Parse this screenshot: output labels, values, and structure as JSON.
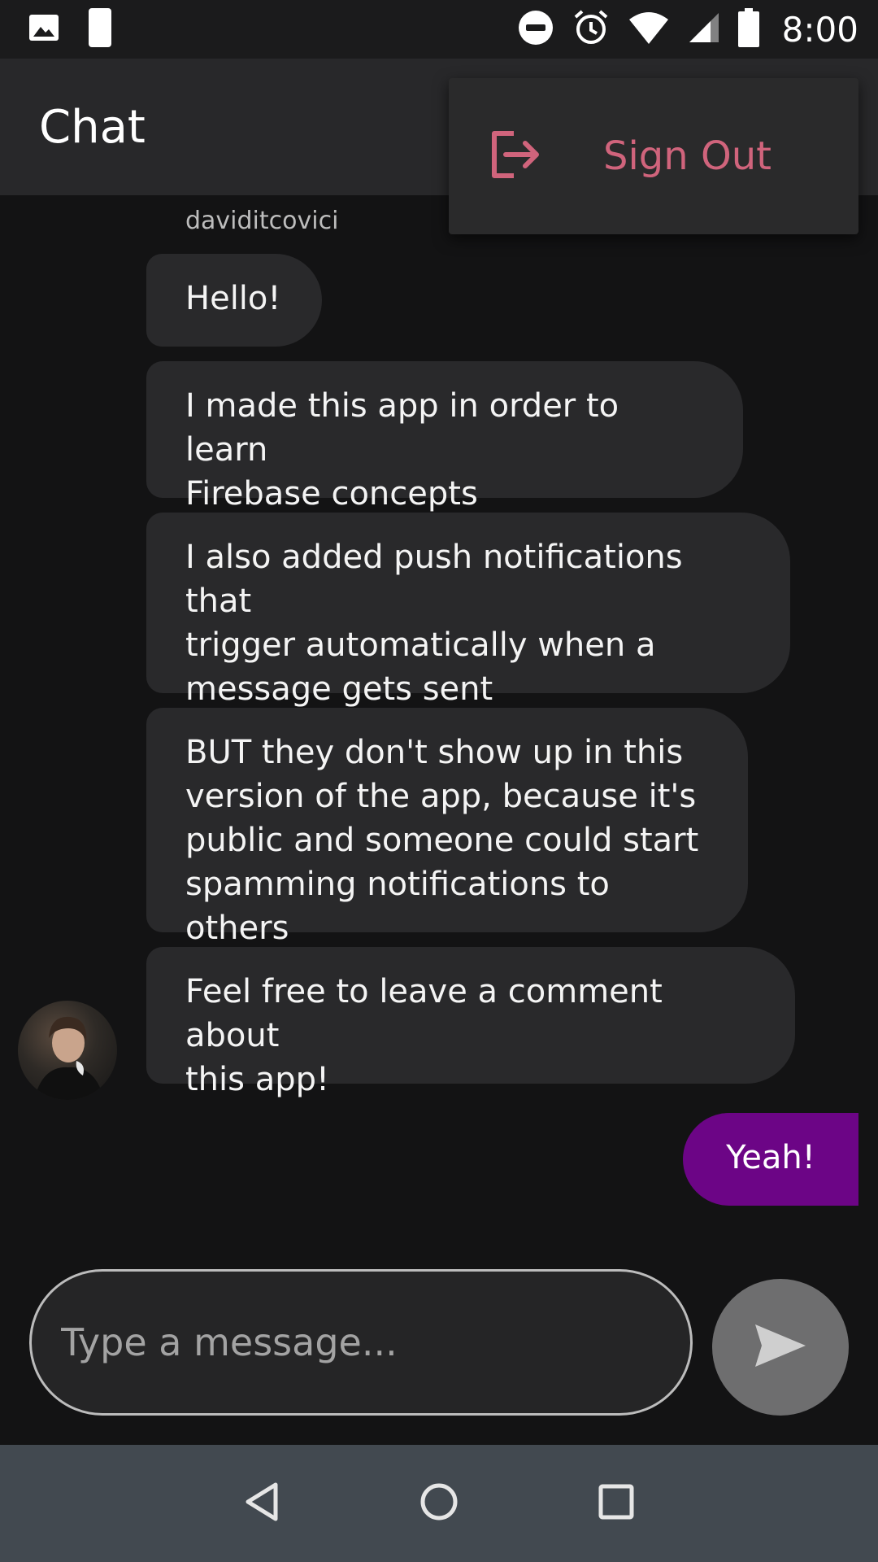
{
  "status_bar": {
    "time": "8:00",
    "left_icons": [
      "image-icon",
      "sim-card-icon"
    ],
    "right_icons": [
      "do-not-disturb-icon",
      "alarm-icon",
      "wifi-icon",
      "signal-icon",
      "battery-icon"
    ]
  },
  "app_bar": {
    "title": "Chat"
  },
  "menu": {
    "sign_out_label": "Sign Out",
    "sign_out_icon": "logout-icon",
    "accent": "#d0647c"
  },
  "conversation": {
    "sender": "daviditcovici",
    "messages": [
      {
        "text": "Hello!",
        "from": "other"
      },
      {
        "text": "I made this app in order to learn\nFirebase concepts",
        "from": "other"
      },
      {
        "text": "I also added push notifications that\ntrigger automatically when a\nmessage gets sent",
        "from": "other"
      },
      {
        "text": "BUT they don't show up in this\nversion of the app, because it's\npublic and someone could start\nspamming notifications to others",
        "from": "other"
      },
      {
        "text": "Feel free to leave a comment about\nthis app!",
        "from": "other"
      },
      {
        "text": "Yeah!",
        "from": "me"
      }
    ]
  },
  "composer": {
    "placeholder": "Type a message...",
    "value": ""
  },
  "colors": {
    "my_bubble": "#6c0586",
    "other_bubble": "#29292b",
    "background": "#131314"
  },
  "nav": {
    "icons": [
      "back-icon",
      "home-icon",
      "recents-icon"
    ]
  }
}
